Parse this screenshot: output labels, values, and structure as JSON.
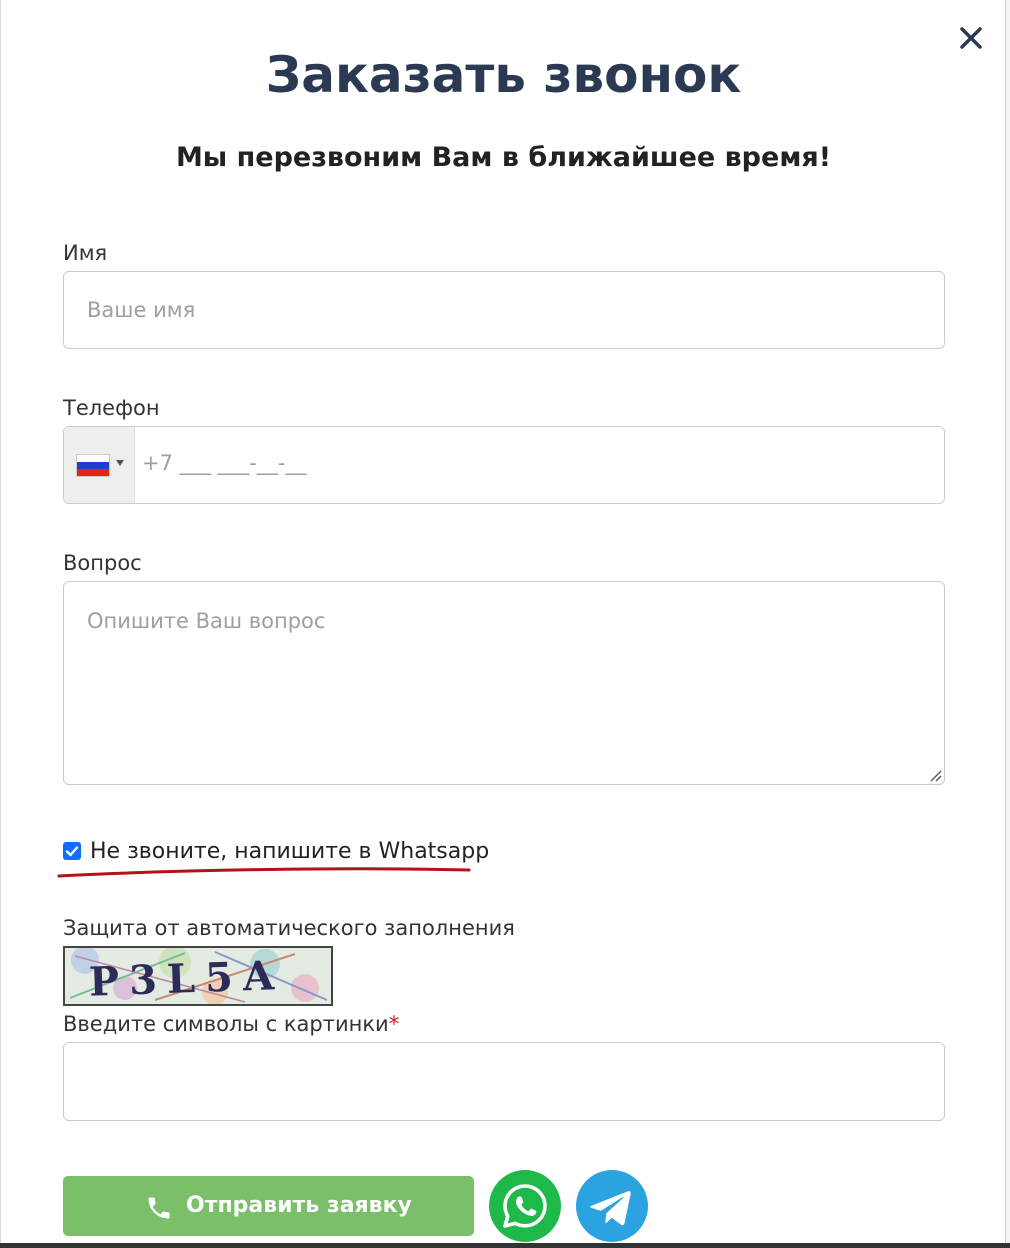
{
  "modal": {
    "title": "Заказать звонок",
    "subtitle": "Мы перезвоним Вам в ближайшее время!"
  },
  "form": {
    "name": {
      "label": "Имя",
      "placeholder": "Ваше имя",
      "value": ""
    },
    "phone": {
      "label": "Телефон",
      "country": "Russia",
      "mask": "+7 ___ ___-__-__",
      "value": ""
    },
    "question": {
      "label": "Вопрос",
      "placeholder": "Опишите Ваш вопрос",
      "value": ""
    },
    "whatsapp_checkbox": {
      "label": "Не звоните, напишите в Whatsapp",
      "checked": true
    },
    "captcha": {
      "label": "Защита от автоматического заполнения",
      "image_text": "P3L5A",
      "input_label": "Введите символы с картинки",
      "required_mark": "*",
      "value": ""
    },
    "submit": {
      "label": "Отправить заявку"
    }
  },
  "colors": {
    "title": "#2b3a52",
    "submit_bg": "#7cbf6a",
    "whatsapp": "#1fb94a",
    "telegram": "#2aa3e0",
    "checkbox": "#0d6efd",
    "highlight_underline": "#b3121a"
  },
  "icons": {
    "close": "close-icon",
    "phone": "phone-icon",
    "whatsapp": "whatsapp-icon",
    "telegram": "telegram-icon",
    "flag": "russia-flag-icon"
  }
}
